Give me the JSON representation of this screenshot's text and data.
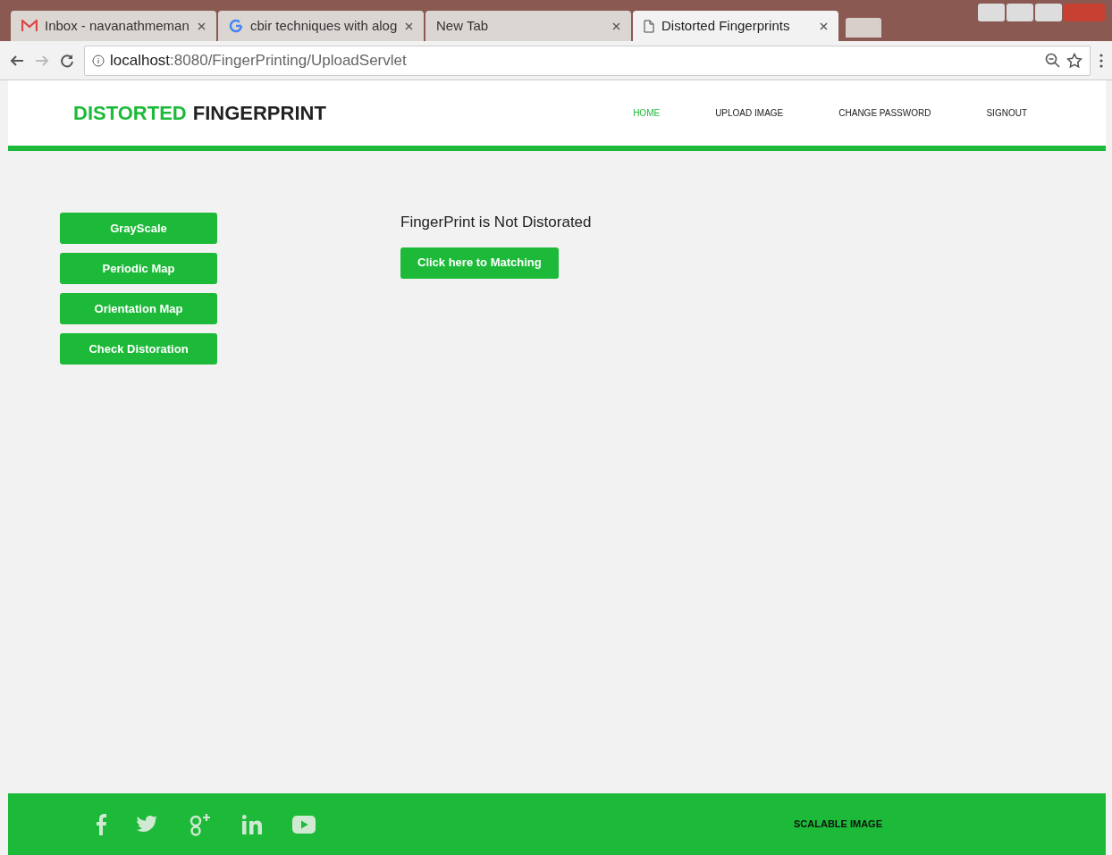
{
  "browser": {
    "tabs": [
      {
        "title": "Inbox - navanathmeman",
        "selected": false
      },
      {
        "title": "cbir techniques with alog",
        "selected": false
      },
      {
        "title": "New Tab",
        "selected": false
      },
      {
        "title": "Distorted Fingerprints",
        "selected": true
      }
    ],
    "url_host": "localhost",
    "url_rest": ":8080/FingerPrinting/UploadServlet"
  },
  "header": {
    "logo_accent": "DISTORTED",
    "logo_rest": "FINGERPRINT",
    "nav": [
      {
        "label": "HOME",
        "selected": true
      },
      {
        "label": "UPLOAD IMAGE",
        "selected": false
      },
      {
        "label": "CHANGE PASSWORD",
        "selected": false
      },
      {
        "label": "SIGNOUT",
        "selected": false
      }
    ]
  },
  "sidebar": {
    "buttons": [
      "GrayScale",
      "Periodic Map",
      "Orientation Map",
      "Check Distoration"
    ]
  },
  "main": {
    "message": "FingerPrint is Not Distorated",
    "button": "Click here to Matching"
  },
  "footer": {
    "credit": "SCALABLE IMAGE"
  }
}
